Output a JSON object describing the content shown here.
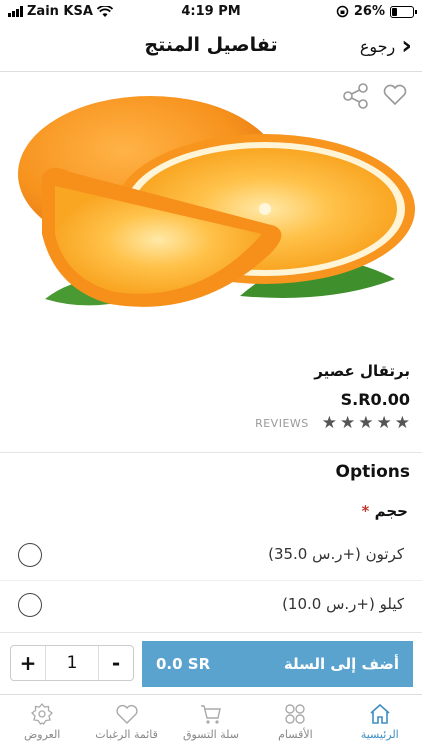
{
  "status": {
    "carrier": "Zain KSA",
    "time": "4:19 PM",
    "battery": "26%",
    "battery_level": 0.26
  },
  "nav": {
    "title": "تفاصيل المنتج",
    "back_label": "رجوع"
  },
  "product": {
    "name": "برتقال عصير",
    "price": "S.R0.00",
    "reviews_label": "REVIEWS",
    "rating_stars": 5
  },
  "options": {
    "title": "Options",
    "group_label": "حجم",
    "required_mark": "*",
    "items": [
      {
        "label": "كرتون (+ر.س 35.0)"
      },
      {
        "label": "كيلو (+ر.س 10.0)"
      }
    ]
  },
  "cart": {
    "quantity": "1",
    "minus": "-",
    "plus": "+",
    "add_label": "أضف إلى السلة",
    "total": "0.0 SR"
  },
  "tabs": [
    {
      "label": "الرئيسية",
      "icon": "home-icon",
      "active": true
    },
    {
      "label": "الأقسام",
      "icon": "grid-icon",
      "active": false
    },
    {
      "label": "سلة التسوق",
      "icon": "cart-icon",
      "active": false
    },
    {
      "label": "قائمة الرغبات",
      "icon": "heart-icon",
      "active": false
    },
    {
      "label": "العروض",
      "icon": "offers-icon",
      "active": false
    }
  ],
  "colors": {
    "accent": "#5aa3cf",
    "tab_active": "#3d8fc5",
    "required": "#c0392b"
  }
}
